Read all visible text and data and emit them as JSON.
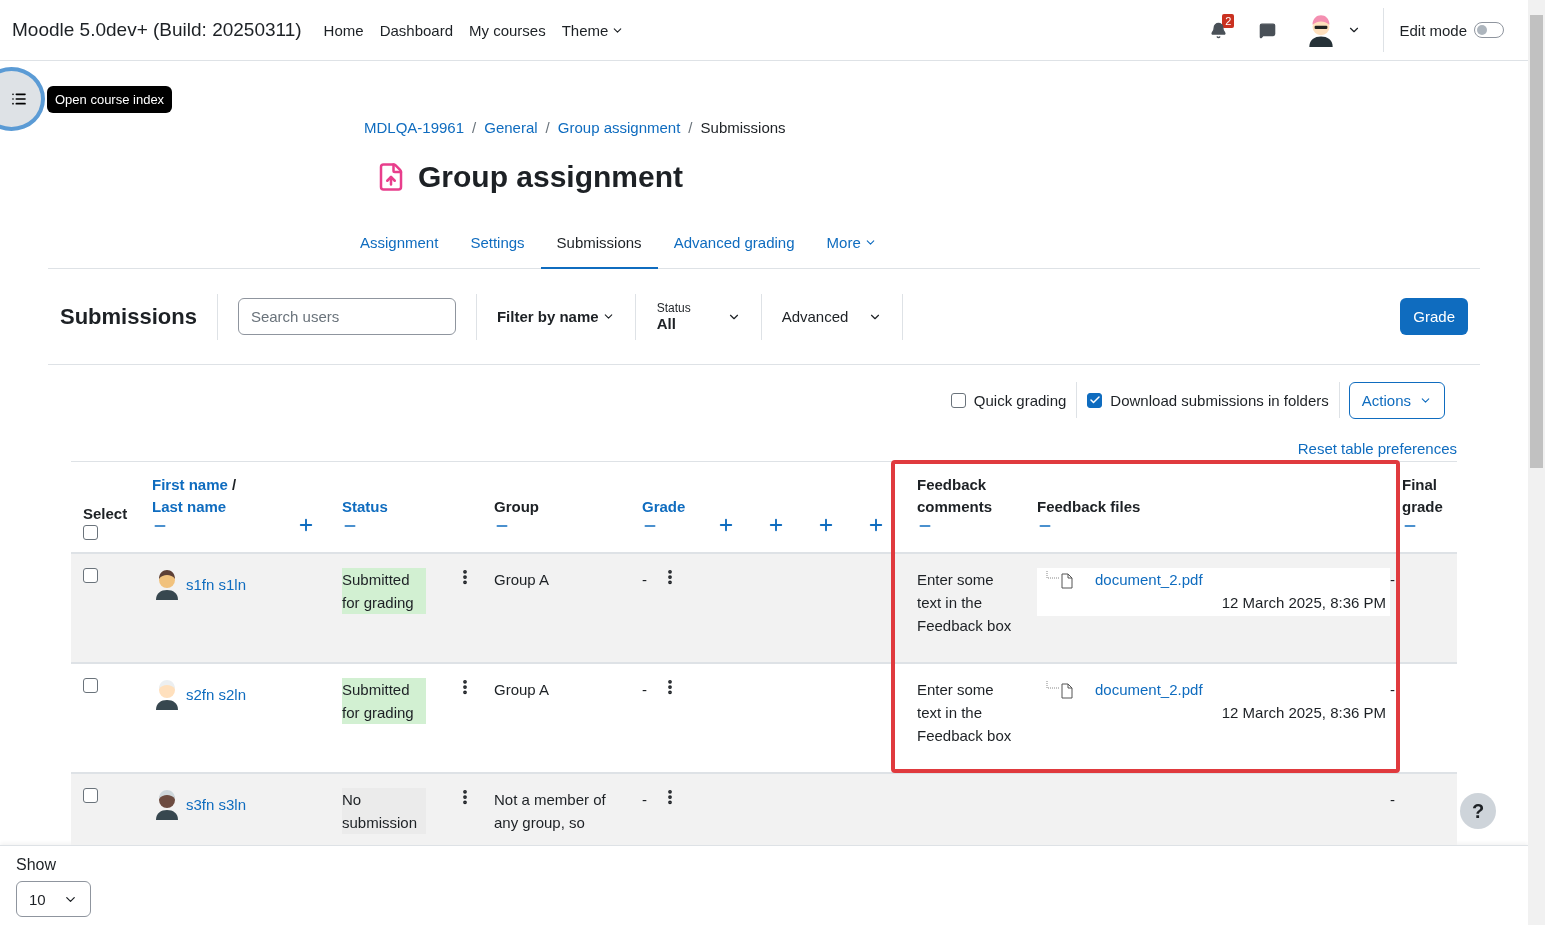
{
  "navbar": {
    "brand": "Moodle 5.0dev+ (Build: 20250311)",
    "links": [
      {
        "label": "Home",
        "dropdown": false
      },
      {
        "label": "Dashboard",
        "dropdown": false
      },
      {
        "label": "My courses",
        "dropdown": false
      },
      {
        "label": "Theme",
        "dropdown": true
      }
    ],
    "notification_count": "2",
    "edit_mode": {
      "label": "Edit mode",
      "on": false
    }
  },
  "course_index": {
    "tooltip": "Open course index"
  },
  "breadcrumb": [
    {
      "label": "MDLQA-19961",
      "link": true
    },
    {
      "separator": "/",
      "label": "General",
      "link": true
    },
    {
      "separator": "/",
      "label": "Group assignment",
      "link": true
    },
    {
      "separator": "/",
      "label": "Submissions",
      "link": false
    }
  ],
  "title": "Group assignment",
  "tabs": [
    {
      "label": "Assignment",
      "selected": false,
      "dropdown": false
    },
    {
      "label": "Settings",
      "selected": false,
      "dropdown": false
    },
    {
      "label": "Submissions",
      "selected": true,
      "dropdown": false
    },
    {
      "label": "Advanced grading",
      "selected": false,
      "dropdown": false
    },
    {
      "label": "More",
      "selected": false,
      "dropdown": true
    }
  ],
  "toolbar": {
    "heading": "Submissions",
    "search": {
      "placeholder": "Search users"
    },
    "filter_name": "Filter by name",
    "status": {
      "label": "Status",
      "value": "All"
    },
    "advanced": "Advanced",
    "grade_button": "Grade"
  },
  "options": {
    "quick_grading": {
      "label": "Quick grading",
      "checked": false
    },
    "download_in_folders": {
      "label": "Download submissions in folders",
      "checked": true
    },
    "actions": "Actions"
  },
  "reset_link": "Reset table preferences",
  "table": {
    "highlight_frame": true,
    "columns": [
      {
        "kind": "select",
        "label": "Select",
        "checked": false
      },
      {
        "kind": "name",
        "first": "First name",
        "separator": "/",
        "last": "Last name"
      },
      {
        "kind": "collapsed"
      },
      {
        "kind": "sortable",
        "label": "Status"
      },
      {
        "kind": "plain",
        "label": "Group"
      },
      {
        "kind": "sortable",
        "label": "Grade"
      },
      {
        "kind": "collapsed"
      },
      {
        "kind": "collapsed"
      },
      {
        "kind": "collapsed"
      },
      {
        "kind": "collapsed"
      },
      {
        "kind": "plain",
        "label": "Feedback comments"
      },
      {
        "kind": "plain",
        "label": "Feedback files"
      },
      {
        "kind": "plain",
        "label": "Final grade"
      }
    ],
    "rows": [
      {
        "checked": false,
        "name": "s1fn s1ln",
        "status": "Submitted for grading",
        "submitted": true,
        "group": "Group A",
        "grade": "-",
        "feedback_comments": "Enter some text in the Feedback box",
        "feedback_file": {
          "name": "document_2.pdf",
          "date": "12 March 2025, 8:36 PM"
        },
        "final_grade": "-"
      },
      {
        "checked": false,
        "name": "s2fn s2ln",
        "status": "Submitted for grading",
        "submitted": true,
        "group": "Group A",
        "grade": "-",
        "feedback_comments": "Enter some text in the Feedback box",
        "feedback_file": {
          "name": "document_2.pdf",
          "date": "12 March 2025, 8:36 PM"
        },
        "final_grade": "-"
      },
      {
        "checked": false,
        "name": "s3fn s3ln",
        "status": "No submission",
        "submitted": false,
        "group": "Not a member of any group, so",
        "grade": "-",
        "final_grade": "-"
      }
    ]
  },
  "help_button": "?",
  "footer": {
    "show_label": "Show",
    "per_page": "10"
  }
}
